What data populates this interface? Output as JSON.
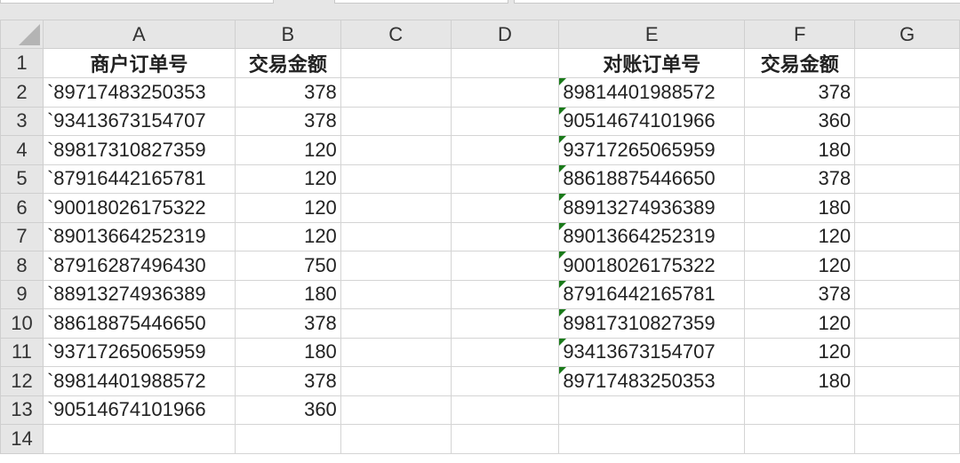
{
  "columns": [
    "A",
    "B",
    "C",
    "D",
    "E",
    "F",
    "G"
  ],
  "rows": [
    "1",
    "2",
    "3",
    "4",
    "5",
    "6",
    "7",
    "8",
    "9",
    "10",
    "11",
    "12",
    "13",
    "14"
  ],
  "left_table": {
    "headers": [
      "商户订单号",
      "交易金额"
    ],
    "data": [
      [
        "`89717483250353",
        "378"
      ],
      [
        "`93413673154707",
        "378"
      ],
      [
        "`89817310827359",
        "120"
      ],
      [
        "`87916442165781",
        "120"
      ],
      [
        "`90018026175322",
        "120"
      ],
      [
        "`89013664252319",
        "120"
      ],
      [
        "`87916287496430",
        "750"
      ],
      [
        "`88913274936389",
        "180"
      ],
      [
        "`88618875446650",
        "378"
      ],
      [
        "`93717265065959",
        "180"
      ],
      [
        "`89814401988572",
        "378"
      ],
      [
        "`90514674101966",
        "360"
      ]
    ]
  },
  "right_table": {
    "headers": [
      "对账订单号",
      "交易金额"
    ],
    "data": [
      [
        "89814401988572",
        "378"
      ],
      [
        "90514674101966",
        "360"
      ],
      [
        "93717265065959",
        "180"
      ],
      [
        "88618875446650",
        "378"
      ],
      [
        "88913274936389",
        "180"
      ],
      [
        "89013664252319",
        "120"
      ],
      [
        "90018026175322",
        "120"
      ],
      [
        "87916442165781",
        "378"
      ],
      [
        "89817310827359",
        "120"
      ],
      [
        "93413673154707",
        "120"
      ],
      [
        "89717483250353",
        "180"
      ]
    ]
  },
  "colors": {
    "header_bg": "#e6e6e6",
    "error_flag": "#1a7a1a",
    "gridline": "#d4d4d4"
  }
}
